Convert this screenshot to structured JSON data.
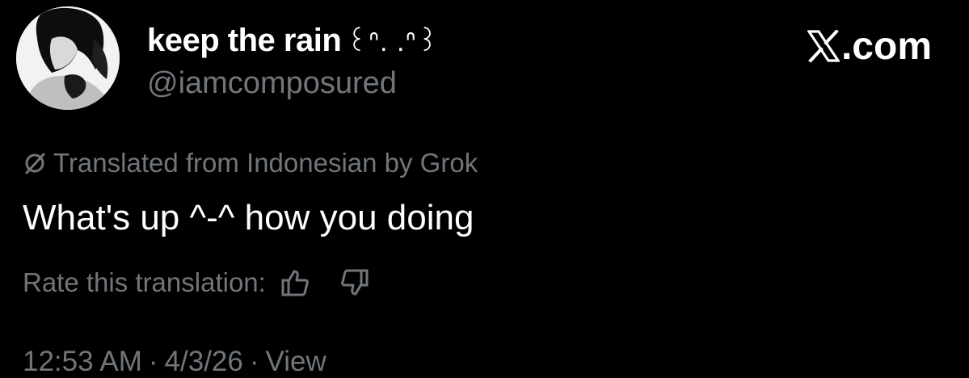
{
  "author": {
    "display_name": "keep the rain",
    "name_emoticon": "꒰ᐢ. .ᐢ꒱",
    "handle": "@iamcomposured",
    "avatar_icon": "profile-avatar"
  },
  "brand": {
    "label": ".com",
    "icon": "x-logo-icon"
  },
  "translation": {
    "note": "Translated from Indonesian by Grok",
    "icon": "grok-icon"
  },
  "tweet": {
    "text": "What's up ^-^ how you doing"
  },
  "rating": {
    "label": "Rate this translation:",
    "up_icon": "thumbs-up-icon",
    "down_icon": "thumbs-down-icon"
  },
  "meta": {
    "time": "12:53 AM",
    "date": "4/3/26",
    "view_label": "View",
    "separator": "·"
  },
  "colors": {
    "background": "#000000",
    "primary_text": "#ffffff",
    "secondary_text": "#71767b"
  }
}
